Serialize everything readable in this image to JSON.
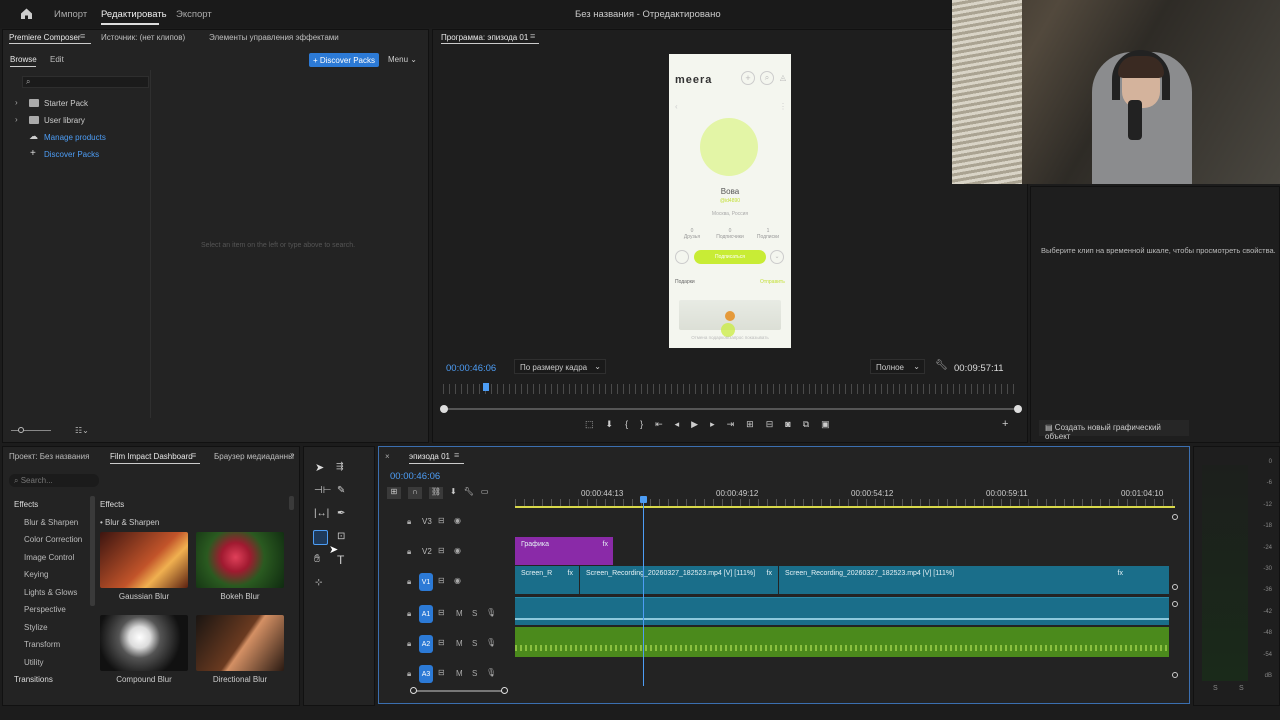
{
  "menubar": {
    "import_label": "Импорт",
    "edit_label": "Редактировать",
    "export_label": "Экспорт",
    "title": "Без названия - Отредактировано"
  },
  "composer": {
    "tabs": [
      "Premiere Composer",
      "Источник: (нет клипов)",
      "Элементы управления эффектами"
    ],
    "browse_label": "Browse",
    "edit_label": "Edit",
    "discover_button": "+ Discover Packs",
    "menu_label": "Menu",
    "tree": [
      "Starter Pack",
      "User library",
      "Manage products",
      "Discover Packs"
    ],
    "empty_hint": "Select an item on the left or type above to search."
  },
  "program": {
    "tab_label": "Программа: эпизода 01",
    "timecode": "00:00:46:06",
    "fit_label": "По размеру кадра",
    "quality_label": "Полное",
    "duration": "00:09:57:11"
  },
  "phone": {
    "app_name": "meera",
    "user_name": "Вова",
    "user_id": "@id4890",
    "location": "Москва, Россия",
    "stats": [
      {
        "value": "0",
        "label": "Друзья"
      },
      {
        "value": "0",
        "label": "Подписчики"
      },
      {
        "value": "1",
        "label": "Подписки"
      }
    ],
    "subscribe_label": "Подписаться",
    "gifts_label": "Подарки",
    "send_label": "Отправить",
    "footer": "Отмена подарков/запрос показывать"
  },
  "properties": {
    "hint": "Выберите клип на временной шкале, чтобы просмотреть свойства.",
    "new_graphic": "Создать новый графический объект"
  },
  "project": {
    "tabs": [
      "Проект: Без названия",
      "Film Impact Dashboard",
      "Браузер медиаданны"
    ],
    "search_placeholder": "Search...",
    "categories": [
      "Effects",
      "Blur & Sharpen",
      "Color Correction",
      "Image Control",
      "Keying",
      "Lights & Glows",
      "Perspective",
      "Stylize",
      "Transform",
      "Utility",
      "Transitions"
    ],
    "effects_header": "Effects",
    "subheader": "Blur & Sharpen",
    "thumbs": [
      "Gaussian Blur",
      "Bokeh Blur",
      "Compound Blur",
      "Directional Blur"
    ]
  },
  "timeline": {
    "tab_label": "эпизода 01",
    "timecode": "00:00:46:06",
    "ruler": [
      "00:00:44:13",
      "00:00:49:12",
      "00:00:54:12",
      "00:00:59:11",
      "00:01:04:10"
    ],
    "tracks": [
      "V3",
      "V2",
      "V1",
      "A1",
      "A2",
      "A3"
    ],
    "graphic_clip": "Графика",
    "clip_a": "Screen_R",
    "clip_b": "Screen_Recording_20260327_182523.mp4 [V] [111%]",
    "clip_c": "Screen_Recording_20260327_182523.mp4 [V] [111%]",
    "fx": "fx"
  },
  "meter": {
    "scale": [
      "0",
      "-6",
      "-12",
      "-18",
      "-24",
      "-30",
      "-36",
      "-42",
      "-48",
      "-54",
      "dB"
    ],
    "solo": [
      "S",
      "S"
    ]
  },
  "colors": {
    "accent": "#2c7ad6",
    "timecode": "#4d9df5",
    "video_clip": "#1a6e8a",
    "audio_clip": "#4b8a1c",
    "graphic_clip": "#8a2aa8"
  }
}
